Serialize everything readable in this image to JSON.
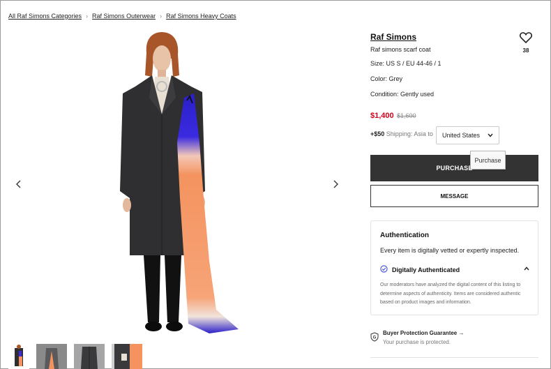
{
  "breadcrumb": [
    {
      "label": "All Raf Simons Categories"
    },
    {
      "label": "Raf Simons Outerwear"
    },
    {
      "label": "Raf Simons Heavy Coats"
    }
  ],
  "gallery": {
    "prev_icon": "chevron-left-icon",
    "next_icon": "chevron-right-icon",
    "thumbnail_count": 4
  },
  "product": {
    "brand": "Raf Simons",
    "title": "Raf simons scarf coat",
    "size": "Size: US S / EU 44-46 / 1",
    "color": "Color: Grey",
    "condition": "Condition: Gently used",
    "price": "$1,400",
    "original_price": "$1,600",
    "favorite_count": "38",
    "favorite_icon": "heart-icon"
  },
  "shipping": {
    "cost": "+$50",
    "label": "Shipping: Asia to",
    "country": "United States"
  },
  "actions": {
    "purchase_label": "PURCHASE",
    "tooltip": "Purchase",
    "message_label": "MESSAGE"
  },
  "authentication": {
    "title": "Authentication",
    "description": "Every item is digitally vetted or expertly inspected.",
    "subtitle": "Digitally Authenticated",
    "body": "Our moderators have analyzed the digital content of this listing to determine aspects of authenticity. Items are considered authentic based on product images and information."
  },
  "protection": {
    "title": "Buyer Protection Guarantee →",
    "subtitle": "Your purchase is protected."
  },
  "colors": {
    "price_red": "#d0021b",
    "button_dark": "#333333",
    "verified_blue": "#3b4bd8"
  }
}
